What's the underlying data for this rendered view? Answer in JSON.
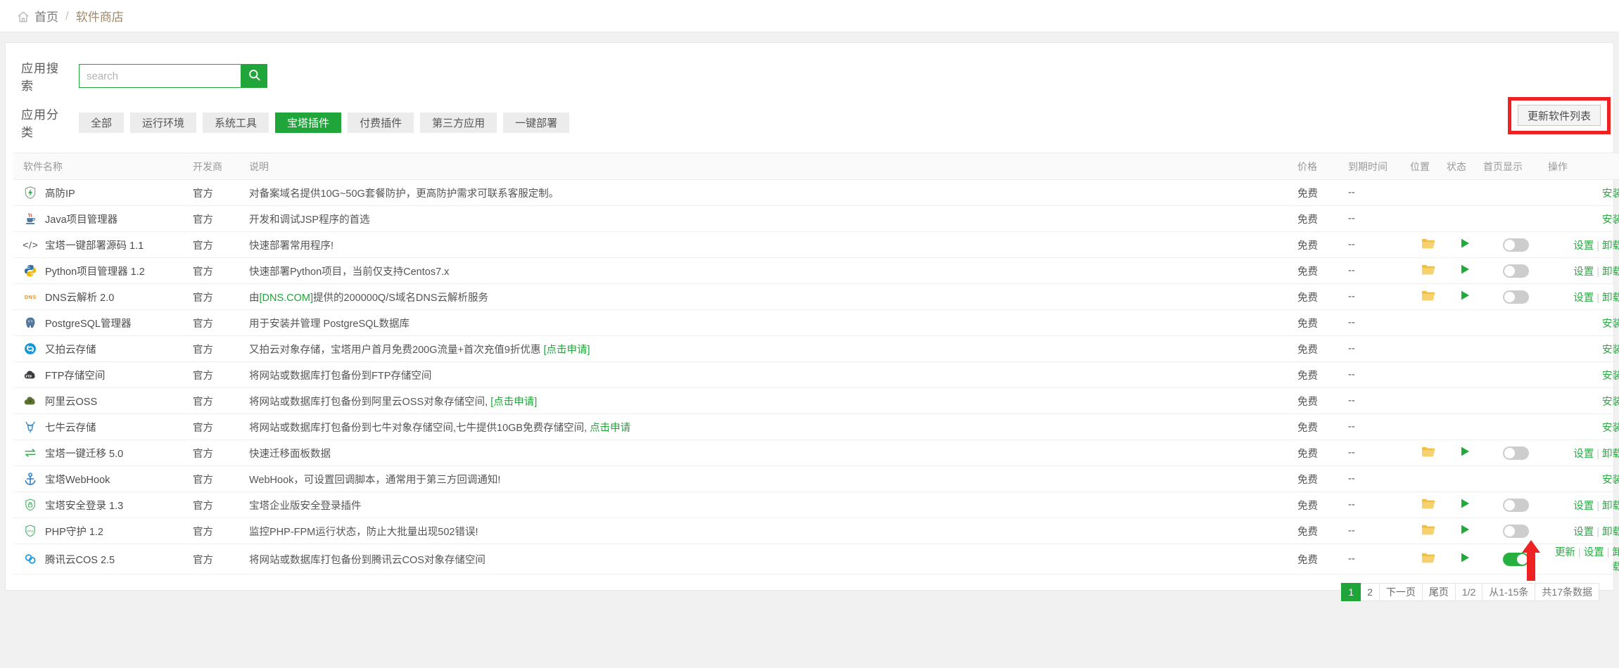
{
  "breadcrumb": {
    "home_icon": "home-icon",
    "home": "首页",
    "separator": "/",
    "current": "软件商店"
  },
  "search": {
    "label": "应用搜索",
    "placeholder": "search",
    "value": "",
    "button_icon": "search-icon"
  },
  "categories": {
    "label": "应用分类",
    "items": [
      {
        "label": "全部",
        "active": false
      },
      {
        "label": "运行环境",
        "active": false
      },
      {
        "label": "系统工具",
        "active": false
      },
      {
        "label": "宝塔插件",
        "active": true
      },
      {
        "label": "付费插件",
        "active": false
      },
      {
        "label": "第三方应用",
        "active": false
      },
      {
        "label": "一键部署",
        "active": false
      }
    ]
  },
  "toolbar": {
    "update_list_label": "更新软件列表",
    "highlight_color": "#ee2222"
  },
  "table": {
    "headers": {
      "name": "软件名称",
      "dev": "开发商",
      "desc": "说明",
      "price": "价格",
      "expiry": "到期时间",
      "position": "位置",
      "state": "状态",
      "home_display": "首页显示",
      "actions": "操作"
    },
    "rows": [
      {
        "icon": "shield-bolt-icon",
        "name": "高防IP",
        "dev": "官方",
        "desc": "对备案域名提供10G~50G套餐防护，更高防护需求可联系客服定制。",
        "desc_link": "",
        "price": "免费",
        "expiry": "--",
        "has_folder": false,
        "has_play": false,
        "has_switch": false,
        "switch_on": false,
        "actions": [
          "安装"
        ]
      },
      {
        "icon": "java-icon",
        "name": "Java项目管理器",
        "dev": "官方",
        "desc": "开发和调试JSP程序的首选",
        "desc_link": "",
        "price": "免费",
        "expiry": "--",
        "has_folder": false,
        "has_play": false,
        "has_switch": false,
        "switch_on": false,
        "actions": [
          "安装"
        ]
      },
      {
        "icon": "code-tag-icon",
        "name": "宝塔一键部署源码 1.1",
        "dev": "官方",
        "desc": "快速部署常用程序!",
        "desc_link": "",
        "price": "免费",
        "expiry": "--",
        "has_folder": true,
        "has_play": true,
        "has_switch": true,
        "switch_on": false,
        "actions": [
          "设置",
          "卸载"
        ]
      },
      {
        "icon": "python-icon",
        "name": "Python项目管理器 1.2",
        "dev": "官方",
        "desc": "快速部署Python项目，当前仅支持Centos7.x",
        "desc_link": "",
        "price": "免费",
        "expiry": "--",
        "has_folder": true,
        "has_play": true,
        "has_switch": true,
        "switch_on": false,
        "actions": [
          "设置",
          "卸载"
        ]
      },
      {
        "icon": "dns-text-icon",
        "name": "DNS云解析 2.0",
        "dev": "官方",
        "desc_pre": "由",
        "desc_link": "[DNS.COM]",
        "desc_post": "提供的200000Q/S域名DNS云解析服务",
        "desc": "",
        "price": "免费",
        "expiry": "--",
        "has_folder": true,
        "has_play": true,
        "has_switch": true,
        "switch_on": false,
        "actions": [
          "设置",
          "卸载"
        ]
      },
      {
        "icon": "postgresql-icon",
        "name": "PostgreSQL管理器",
        "dev": "官方",
        "desc": "用于安装并管理 PostgreSQL数据库",
        "desc_link": "",
        "price": "免费",
        "expiry": "--",
        "has_folder": false,
        "has_play": false,
        "has_switch": false,
        "switch_on": false,
        "actions": [
          "安装"
        ]
      },
      {
        "icon": "upyun-icon",
        "name": "又拍云存储",
        "dev": "官方",
        "desc_pre": "又拍云对象存储，宝塔用户首月免费200G流量+首次充值9折优惠 ",
        "desc_link": "[点击申请]",
        "desc_post": "",
        "desc": "",
        "price": "免费",
        "expiry": "--",
        "has_folder": false,
        "has_play": false,
        "has_switch": false,
        "switch_on": false,
        "actions": [
          "安装"
        ]
      },
      {
        "icon": "ftp-cloud-icon",
        "name": "FTP存储空间",
        "dev": "官方",
        "desc": "将网站或数据库打包备份到FTP存储空间",
        "desc_link": "",
        "price": "免费",
        "expiry": "--",
        "has_folder": false,
        "has_play": false,
        "has_switch": false,
        "switch_on": false,
        "actions": [
          "安装"
        ]
      },
      {
        "icon": "aliyun-oss-icon",
        "name": "阿里云OSS",
        "dev": "官方",
        "desc_pre": "将网站或数据库打包备份到阿里云OSS对象存储空间, ",
        "desc_link": "[点击申请]",
        "desc_post": "",
        "desc": "",
        "price": "免费",
        "expiry": "--",
        "has_folder": false,
        "has_play": false,
        "has_switch": false,
        "switch_on": false,
        "actions": [
          "安装"
        ]
      },
      {
        "icon": "qiniu-icon",
        "name": "七牛云存储",
        "dev": "官方",
        "desc_pre": "将网站或数据库打包备份到七牛对象存储空间,七牛提供10GB免费存储空间, ",
        "desc_link": "点击申请",
        "desc_post": "",
        "desc": "",
        "price": "免费",
        "expiry": "--",
        "has_folder": false,
        "has_play": false,
        "has_switch": false,
        "switch_on": false,
        "actions": [
          "安装"
        ]
      },
      {
        "icon": "migrate-arrows-icon",
        "name": "宝塔一键迁移 5.0",
        "dev": "官方",
        "desc": "快速迁移面板数据",
        "desc_link": "",
        "price": "免费",
        "expiry": "--",
        "has_folder": true,
        "has_play": true,
        "has_switch": true,
        "switch_on": false,
        "actions": [
          "设置",
          "卸载"
        ]
      },
      {
        "icon": "anchor-icon",
        "name": "宝塔WebHook",
        "dev": "官方",
        "desc": "WebHook，可设置回调脚本，通常用于第三方回调通知!",
        "desc_link": "",
        "price": "免费",
        "expiry": "--",
        "has_folder": false,
        "has_play": false,
        "has_switch": false,
        "switch_on": false,
        "actions": [
          "安装"
        ]
      },
      {
        "icon": "shield-lock-icon",
        "name": "宝塔安全登录 1.3",
        "dev": "官方",
        "desc": "宝塔企业版安全登录插件",
        "desc_link": "",
        "price": "免费",
        "expiry": "--",
        "has_folder": true,
        "has_play": true,
        "has_switch": true,
        "switch_on": false,
        "actions": [
          "设置",
          "卸载"
        ]
      },
      {
        "icon": "shield-php-icon",
        "name": "PHP守护 1.2",
        "dev": "官方",
        "desc": "监控PHP-FPM运行状态，防止大批量出现502错误!",
        "desc_link": "",
        "price": "免费",
        "expiry": "--",
        "has_folder": true,
        "has_play": true,
        "has_switch": true,
        "switch_on": false,
        "actions": [
          "设置",
          "卸载"
        ]
      },
      {
        "icon": "tencent-cos-icon",
        "name": "腾讯云COS 2.5",
        "dev": "官方",
        "desc": "将网站或数据库打包备份到腾讯云COS对象存储空间",
        "desc_link": "",
        "price": "免费",
        "expiry": "--",
        "has_folder": true,
        "has_play": true,
        "has_switch": true,
        "switch_on": true,
        "actions": [
          "更新",
          "设置",
          "卸载"
        ]
      }
    ]
  },
  "pagination": {
    "pages": [
      "1",
      "2"
    ],
    "current": "1",
    "next_label": "下一页",
    "last_label": "尾页",
    "page_of": "1/2",
    "range": "从1-15条",
    "total": "共17条数据"
  },
  "annotations": {
    "arrow_color": "#ee2222",
    "arrow_target": "更新"
  }
}
